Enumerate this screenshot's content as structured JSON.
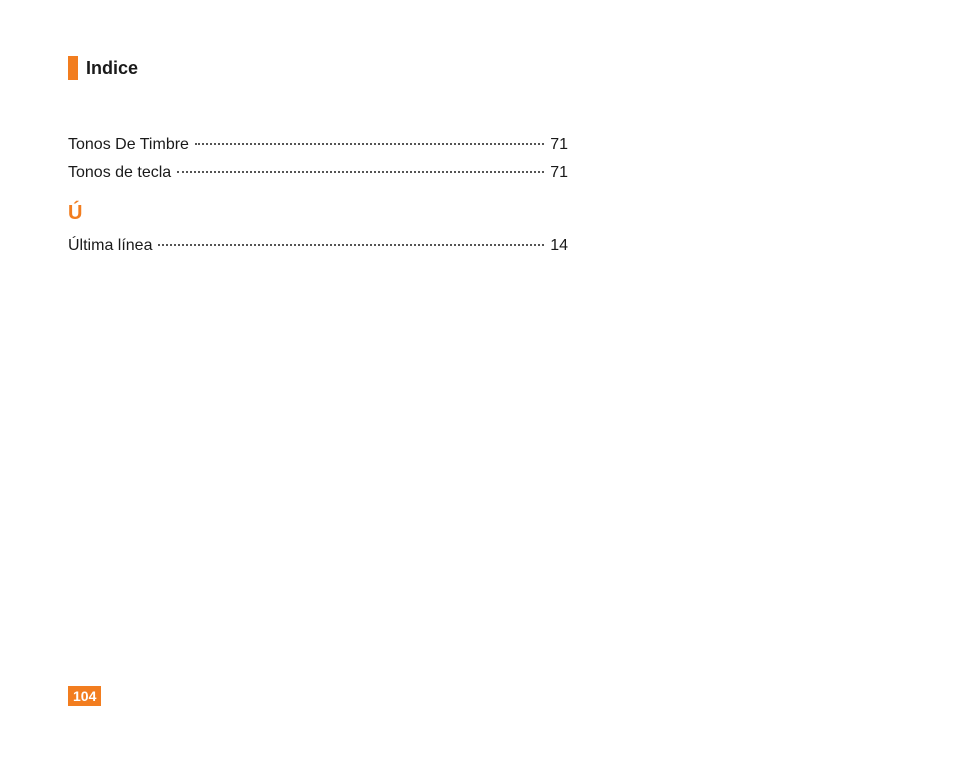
{
  "header": {
    "title": "Indice"
  },
  "toc": {
    "entries_top": [
      {
        "label": "Tonos De Timbre",
        "page": "71"
      },
      {
        "label": "Tonos de tecla",
        "page": "71"
      }
    ],
    "section_letter": "Ú",
    "entries_section": [
      {
        "label": "Última línea",
        "page": "14"
      }
    ]
  },
  "page_number": "104"
}
